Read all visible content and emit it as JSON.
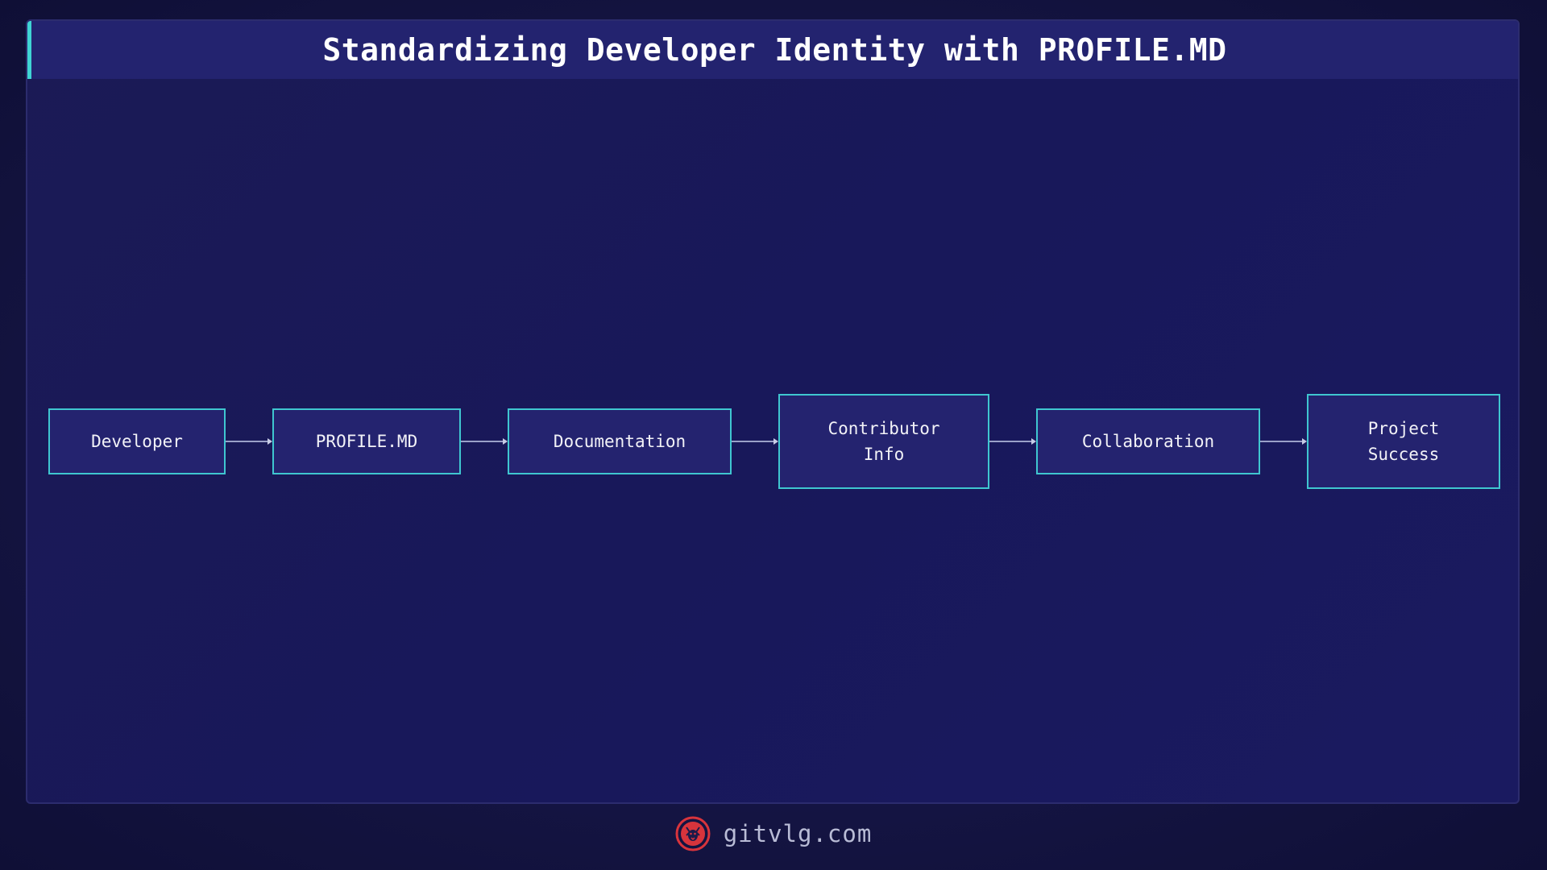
{
  "header": {
    "title": "Standardizing Developer Identity with PROFILE.MD"
  },
  "diagram": {
    "nodes": [
      {
        "id": "developer",
        "label": "Developer"
      },
      {
        "id": "profile",
        "label": "PROFILE.MD"
      },
      {
        "id": "documentation",
        "label": "Documentation"
      },
      {
        "id": "contributor",
        "label": "Contributor\nInfo"
      },
      {
        "id": "collaboration",
        "label": "Collaboration"
      },
      {
        "id": "success",
        "label": "Project\nSuccess"
      }
    ],
    "edges": [
      {
        "from": "developer",
        "to": "profile"
      },
      {
        "from": "profile",
        "to": "documentation"
      },
      {
        "from": "documentation",
        "to": "contributor"
      },
      {
        "from": "contributor",
        "to": "collaboration"
      },
      {
        "from": "collaboration",
        "to": "success"
      }
    ]
  },
  "footer": {
    "site": "gitvlg.com",
    "logo_icon": "lion-logo-icon"
  },
  "colors": {
    "accent": "#3fd4d4",
    "node_border": "#3fc6d0",
    "logo": "#d8343c"
  }
}
